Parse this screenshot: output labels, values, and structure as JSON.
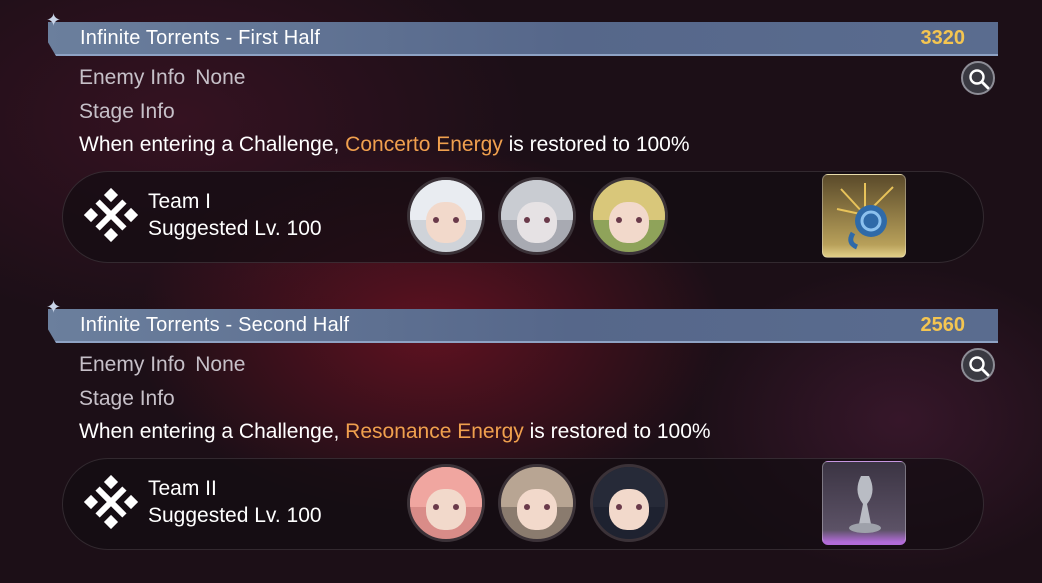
{
  "stages": [
    {
      "title": "Infinite Torrents - First Half",
      "score": "3320",
      "enemy_label": "Enemy Info",
      "enemy_value": "None",
      "stage_label": "Stage Info",
      "desc_prefix": "When entering a Challenge, ",
      "desc_highlight": "Concerto Energy",
      "desc_suffix": " is restored to 100%",
      "team_name": "Team I",
      "team_level": "Suggested Lv. 100",
      "item_rarity_color": "#e2cf88"
    },
    {
      "title": "Infinite Torrents - Second Half",
      "score": "2560",
      "enemy_label": "Enemy Info",
      "enemy_value": "None",
      "stage_label": "Stage Info",
      "desc_prefix": "When entering a Challenge, ",
      "desc_highlight": "Resonance Energy",
      "desc_suffix": " is restored to 100%",
      "team_name": "Team II",
      "team_level": "Suggested Lv. 100",
      "item_rarity_color": "#b26bd8"
    }
  ],
  "colors": {
    "header_bar": "#5f7294",
    "score": "#f4c551",
    "highlight": "#f0a04e"
  },
  "icons": {
    "search": "magnifier-icon",
    "team": "crossed-swords-icon",
    "header_spark": "sparkle-icon"
  }
}
